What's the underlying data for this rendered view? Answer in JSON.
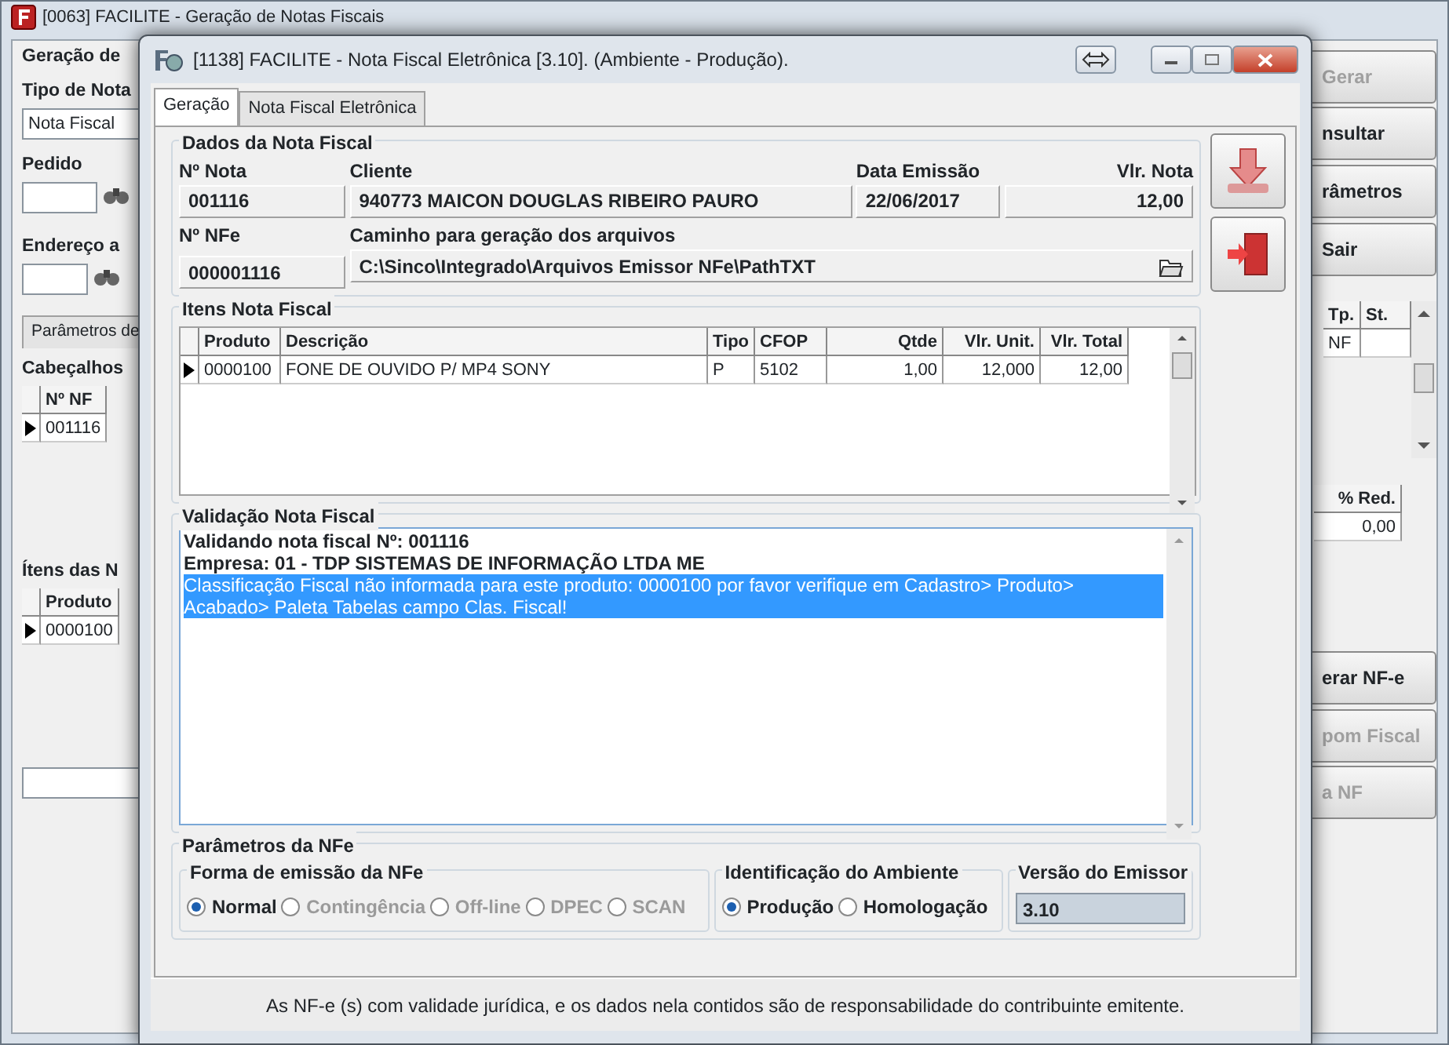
{
  "back_window": {
    "title": "[0063] FACILITE - Geração de Notas Fiscais",
    "left": {
      "group_title": "Geração de",
      "tipo_label": "Tipo de Nota",
      "tipo_value": "Nota Fiscal",
      "pedido_label": "Pedido",
      "endereco_label": "Endereço a",
      "tab": "Parâmetros de",
      "cabecalhos_label": "Cabeçalhos",
      "cab_column": "Nº NF",
      "cab_row": "001116",
      "itens_label": "Ítens das N",
      "itens_column": "Produto",
      "itens_row": "0000100"
    },
    "right": {
      "buttons": [
        {
          "label": "Gerar",
          "disabled": true
        },
        {
          "label": "nsultar",
          "disabled": false
        },
        {
          "label": "râmetros",
          "disabled": false
        },
        {
          "label": "Sair",
          "disabled": false
        }
      ],
      "cab_columns": [
        "Tp.",
        "St."
      ],
      "cab_row": [
        "NF"
      ],
      "itens_column": "% Red.",
      "itens_row": "0,00",
      "lower_buttons": [
        {
          "label": "erar NF-e",
          "disabled": false
        },
        {
          "label": "pom Fiscal",
          "disabled": true
        },
        {
          "label": "a NF",
          "disabled": true
        }
      ]
    }
  },
  "window": {
    "title": "[1138] FACILITE - Nota Fiscal Eletrônica [3.10]. (Ambiente - Produção).",
    "tabs": [
      {
        "label": "Geração",
        "selected": true
      },
      {
        "label": "Nota Fiscal Eletrônica",
        "selected": false
      }
    ],
    "dados": {
      "title": "Dados da Nota Fiscal",
      "fields": [
        {
          "label": "Nº Nota",
          "value": "001116"
        },
        {
          "label": "Cliente",
          "value": "940773 MAICON DOUGLAS RIBEIRO PAURO"
        },
        {
          "label": "Data Emissão",
          "value": "22/06/2017"
        },
        {
          "label": "Vlr. Nota",
          "value": "12,00"
        }
      ],
      "nfe_label": "Nº NFe",
      "nfe_value": "000001116",
      "path_label": "Caminho para geração dos arquivos",
      "path_value": "C:\\Sinco\\Integrado\\Arquivos Emissor NFe\\PathTXT"
    },
    "itens": {
      "title": "Itens Nota Fiscal",
      "columns": [
        "Produto",
        "Descrição",
        "Tipo",
        "CFOP",
        "Qtde",
        "Vlr. Unit.",
        "Vlr. Total"
      ],
      "rows": [
        [
          "0000100",
          "FONE DE OUVIDO P/ MP4 SONY",
          "P",
          "5102",
          "1,00",
          "12,000",
          "12,00"
        ]
      ]
    },
    "validacao": {
      "title": "Validação Nota Fiscal",
      "lines": [
        {
          "text": "Validando nota fiscal Nº: 001116",
          "selected": false
        },
        {
          "text": "Empresa: 01 - TDP SISTEMAS DE INFORMAÇÃO LTDA ME",
          "selected": false
        },
        {
          "text": "Classificação Fiscal não informada para este produto: 0000100 por favor verifique em Cadastro> Produto> Acabado> Paleta Tabelas campo Clas. Fiscal!",
          "selected": true
        }
      ]
    },
    "parametros": {
      "title": "Parâmetros da NFe",
      "forma": {
        "title": "Forma de emissão da NFe",
        "options": [
          {
            "label": "Normal",
            "selected": true,
            "disabled": false
          },
          {
            "label": "Contingência",
            "selected": false,
            "disabled": true
          },
          {
            "label": "Off-line",
            "selected": false,
            "disabled": true
          },
          {
            "label": "DPEC",
            "selected": false,
            "disabled": true
          },
          {
            "label": "SCAN",
            "selected": false,
            "disabled": true
          }
        ]
      },
      "ambiente": {
        "title": "Identificação do Ambiente",
        "options": [
          {
            "label": "Produção",
            "selected": true,
            "disabled": false
          },
          {
            "label": "Homologação",
            "selected": false,
            "disabled": false
          }
        ]
      },
      "versao": {
        "title": "Versão do Emissor",
        "value": "3.10"
      }
    },
    "footer": "As NF-e (s) com validade jurídica, e os dados nela contidos são de responsabilidade do contribuinte emitente."
  }
}
